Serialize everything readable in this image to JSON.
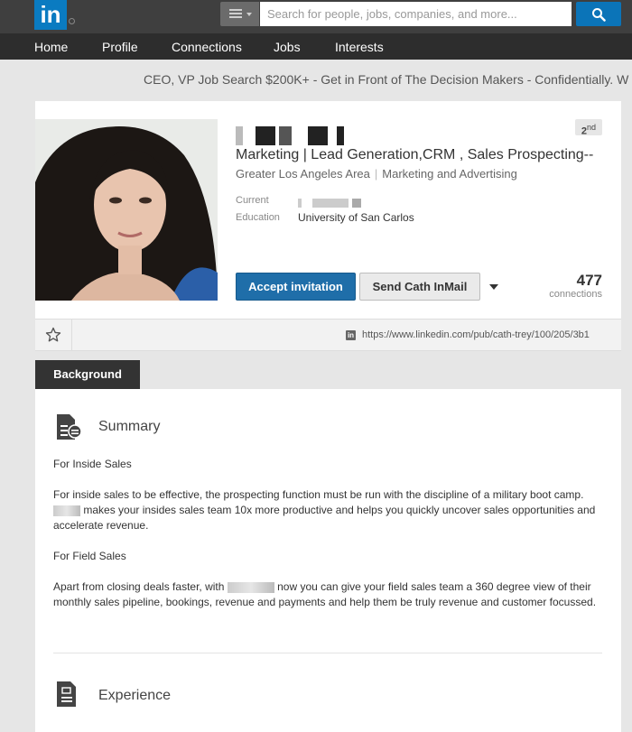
{
  "header": {
    "logo_text": "in",
    "search_placeholder": "Search for people, jobs, companies, and more..."
  },
  "nav": {
    "items": [
      "Home",
      "Profile",
      "Connections",
      "Jobs",
      "Interests"
    ]
  },
  "ad": {
    "text": "CEO, VP Job Search $200K+ - Get in Front of The Decision Makers - Confidentially. W"
  },
  "profile": {
    "degree": "2",
    "degree_suffix": "nd",
    "headline": "Marketing | Lead Generation,CRM , Sales Prospecting--",
    "location": "Greater Los Angeles Area",
    "industry": "Marketing and Advertising",
    "current_label": "Current",
    "education_label": "Education",
    "education_value": "University of San Carlos",
    "accept_label": "Accept invitation",
    "inmail_label": "Send Cath InMail",
    "connections_count": "477",
    "connections_label": "connections",
    "public_url": "https://www.linkedin.com/pub/cath-trey/100/205/3b1"
  },
  "background": {
    "tab_label": "Background",
    "summary_title": "Summary",
    "p1": "For Inside Sales",
    "p2a": "For inside sales to be effective, the prospecting function must be run with the discipline of a military boot camp.",
    "p2b": "makes your insides sales team 10x more productive and helps you quickly uncover sales opportunities and accelerate revenue.",
    "p3": "For Field Sales",
    "p4a": "Apart from closing deals faster, with",
    "p4b": "now you can give your field sales team a 360 degree view of their monthly sales pipeline, bookings, revenue and payments and help them be truly revenue and customer focussed.",
    "experience_title": "Experience"
  },
  "colors": {
    "brand": "#0a7bc1",
    "primary_button": "#1f6ea9",
    "topbar": "#3f3f3f",
    "navbar": "#2d2d2d"
  },
  "icons": [
    "menu-icon",
    "search-icon",
    "star-icon",
    "linkedin-mini-icon",
    "summary-document-icon",
    "experience-document-icon",
    "dropdown-caret-icon"
  ]
}
